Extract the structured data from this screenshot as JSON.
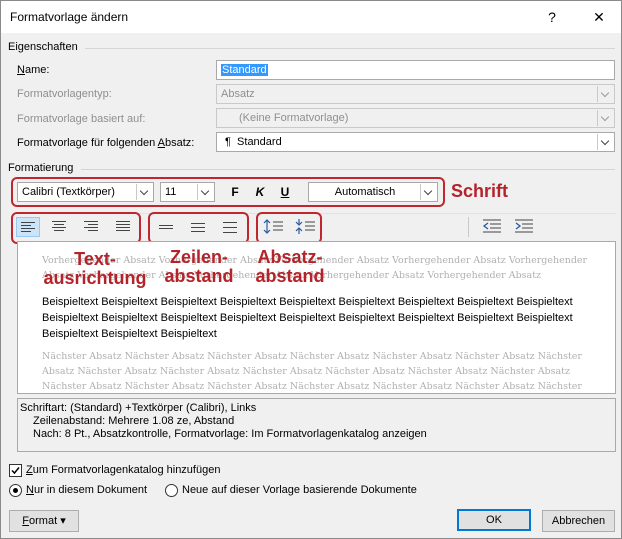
{
  "window": {
    "title": "Formatvorlage ändern",
    "help": "?",
    "close": "✕"
  },
  "properties": {
    "heading": "Eigenschaften",
    "name_label": "Name:",
    "name_value": "Standard",
    "type_label": "Formatvorlagentyp:",
    "type_value": "Absatz",
    "based_label": "Formatvorlage basiert auf:",
    "based_value": "(Keine Formatvorlage)",
    "following_label": "Formatvorlage für folgenden Absatz:",
    "following_value": "Standard",
    "following_icon": "¶"
  },
  "formatting": {
    "heading": "Formatierung",
    "font": "Calibri (Textkörper)",
    "size": "11",
    "bold": "F",
    "italic": "K",
    "underline": "U",
    "color": "Automatisch"
  },
  "annotations": {
    "schrift": "Schrift",
    "ausrichtung_1": "Text-",
    "ausrichtung_2": "ausrichtung",
    "zeilen_1": "Zeilen-",
    "zeilen_2": "abstand",
    "absatz_1": "Absatz-",
    "absatz_2": "abstand",
    "color": "#c0262d"
  },
  "preview": {
    "prev_line_1": "Vorhergehender Absatz Vorhergehender Absatz Vorhergehender Absatz Vorhergehender Absatz Vorhergehender",
    "prev_line_2": "Absatz Vorhergehender Absatz Vorhergehender Absatz Vorhergehender Absatz Vorhergehender Absatz",
    "main_text": "Beispieltext Beispieltext Beispieltext Beispieltext Beispieltext Beispieltext Beispieltext Beispieltext Beispieltext Beispieltext Beispieltext Beispieltext Beispieltext Beispieltext Beispieltext Beispieltext Beispieltext Beispieltext Beispieltext Beispieltext Beispieltext",
    "next_line_1": "Nächster Absatz Nächster Absatz Nächster Absatz Nächster Absatz Nächster Absatz Nächster Absatz Nächster",
    "next_line_2": "Absatz Nächster Absatz Nächster Absatz Nächster Absatz Nächster Absatz Nächster Absatz Nächster Absatz",
    "next_line_3": "Nächster Absatz Nächster Absatz Nächster Absatz Nächster Absatz Nächster Absatz Nächster Absatz Nächster"
  },
  "description": {
    "line_1": "Schriftart: (Standard) +Textkörper (Calibri), Links",
    "line_2": "Zeilenabstand:  Mehrere 1.08 ze, Abstand",
    "line_3": "Nach:  8 Pt., Absatzkontrolle, Formatvorlage: Im Formatvorlagenkatalog anzeigen"
  },
  "options": {
    "add_to_gallery": "Zum Formatvorlagenkatalog hinzufügen",
    "add_to_gallery_checked": true,
    "only_this_doc": "Nur in diesem Dokument",
    "new_docs": "Neue auf dieser Vorlage basierende Dokumente"
  },
  "buttons": {
    "format": "Format",
    "ok": "OK",
    "cancel": "Abbrechen"
  }
}
